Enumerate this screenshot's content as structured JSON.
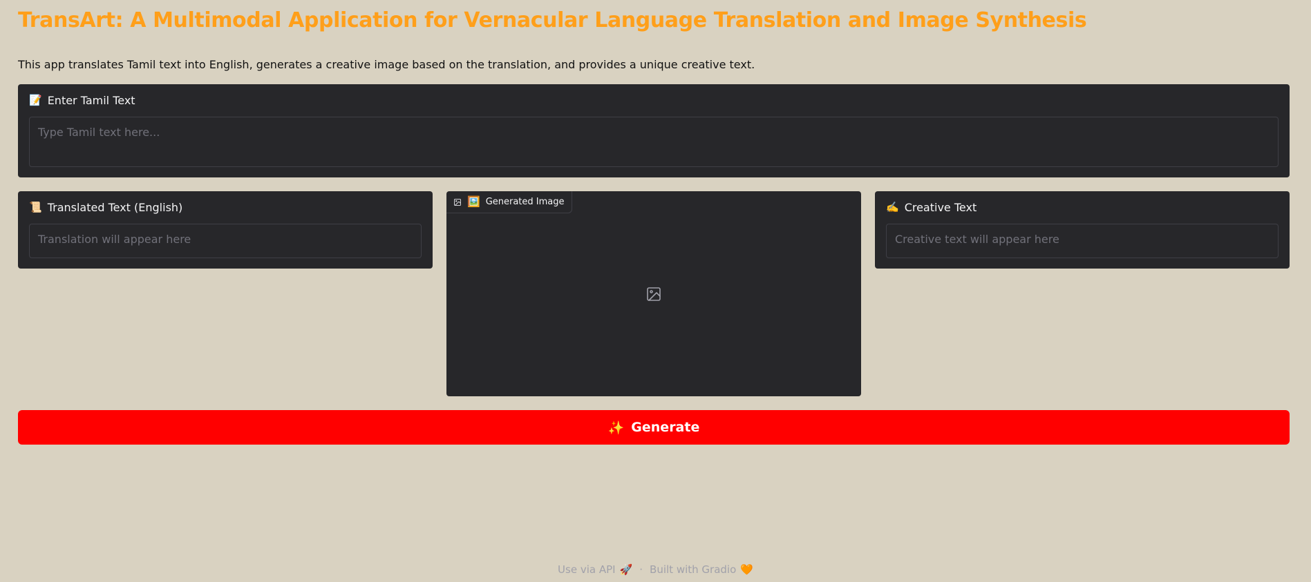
{
  "header": {
    "title": "TransArt: A Multimodal Application for Vernacular Language Translation and Image Synthesis",
    "description": "This app translates Tamil text into English, generates a creative image based on the translation, and provides a unique creative text."
  },
  "tamil_input": {
    "emoji": "📝",
    "label": "Enter Tamil Text",
    "placeholder": "Type Tamil text here..."
  },
  "translated_output": {
    "emoji": "📜",
    "label": "Translated Text (English)",
    "placeholder": "Translation will appear here"
  },
  "image_output": {
    "emoji": "🖼️",
    "label": "Generated Image"
  },
  "creative_output": {
    "emoji": "✍️",
    "label": "Creative Text",
    "placeholder": "Creative text will appear here"
  },
  "generate_button": {
    "emoji": "✨",
    "label": "Generate",
    "color": "#ff0000"
  },
  "footer": {
    "api_link": "Use via API",
    "api_emoji": "🚀",
    "separator": "·",
    "built_with": "Built with Gradio",
    "gradio_emoji": "🧡"
  },
  "theme": {
    "background": "#d9d2c1",
    "title_color": "#ff9f1a",
    "panel_color": "#27272a"
  }
}
